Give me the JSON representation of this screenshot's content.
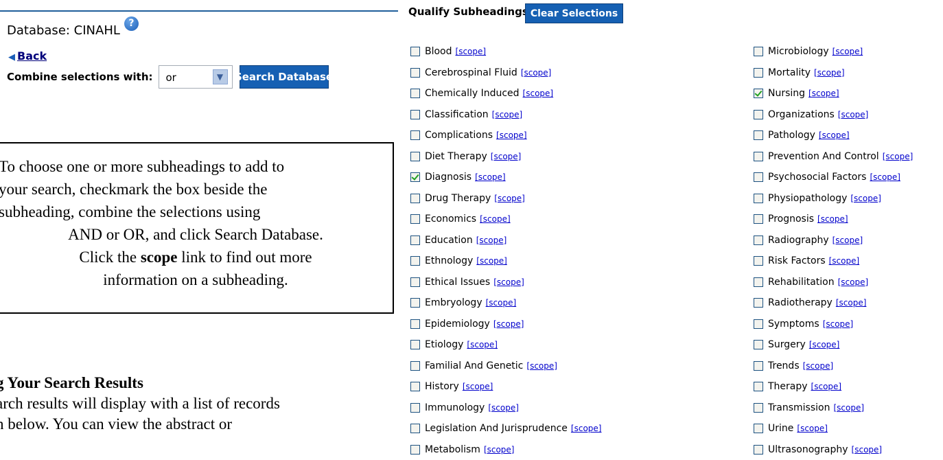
{
  "header": {
    "database_label": "Database: CINAHL",
    "help_icon": "question-circle-icon",
    "back_label": "Back",
    "combine_label": "Combine selections with:",
    "combine_value": "or",
    "search_button": "Search Database"
  },
  "instructions": {
    "lines": [
      "To choose one or more subheadings to add to",
      "your search, checkmark the box beside the",
      "subheading, combine the selections using",
      "AND or OR, and click Search Database.",
      "Click the ",
      "scope",
      " link to find out more",
      "information on a subheading."
    ]
  },
  "viewing": {
    "title_prefix": "g ",
    "title": "Your Search Results",
    "line1": "arch results will display with a list of records",
    "line2": "n below.  You can view the abstract or"
  },
  "subheadings": {
    "label": "Qualify Subheadings:",
    "clear_button": "Clear Selections",
    "scope_text": "[scope]",
    "left": [
      {
        "label": "Blood",
        "checked": false
      },
      {
        "label": "Cerebrospinal Fluid",
        "checked": false
      },
      {
        "label": "Chemically Induced",
        "checked": false
      },
      {
        "label": "Classification",
        "checked": false
      },
      {
        "label": "Complications",
        "checked": false
      },
      {
        "label": "Diet Therapy",
        "checked": false
      },
      {
        "label": "Diagnosis",
        "checked": true
      },
      {
        "label": "Drug Therapy",
        "checked": false
      },
      {
        "label": "Economics",
        "checked": false
      },
      {
        "label": "Education",
        "checked": false
      },
      {
        "label": "Ethnology",
        "checked": false
      },
      {
        "label": "Ethical Issues",
        "checked": false
      },
      {
        "label": "Embryology",
        "checked": false
      },
      {
        "label": "Epidemiology",
        "checked": false
      },
      {
        "label": "Etiology",
        "checked": false
      },
      {
        "label": "Familial And Genetic",
        "checked": false
      },
      {
        "label": "History",
        "checked": false
      },
      {
        "label": "Immunology",
        "checked": false
      },
      {
        "label": "Legislation And Jurisprudence",
        "checked": false
      },
      {
        "label": "Metabolism",
        "checked": false
      }
    ],
    "right": [
      {
        "label": "Microbiology",
        "checked": false
      },
      {
        "label": "Mortality",
        "checked": false
      },
      {
        "label": "Nursing",
        "checked": true
      },
      {
        "label": "Organizations",
        "checked": false
      },
      {
        "label": "Pathology",
        "checked": false
      },
      {
        "label": "Prevention And Control",
        "checked": false
      },
      {
        "label": "Psychosocial Factors",
        "checked": false
      },
      {
        "label": "Physiopathology",
        "checked": false
      },
      {
        "label": "Prognosis",
        "checked": false
      },
      {
        "label": "Radiography",
        "checked": false
      },
      {
        "label": "Risk Factors",
        "checked": false
      },
      {
        "label": "Rehabilitation",
        "checked": false
      },
      {
        "label": "Radiotherapy",
        "checked": false
      },
      {
        "label": "Symptoms",
        "checked": false
      },
      {
        "label": "Surgery",
        "checked": false
      },
      {
        "label": "Trends",
        "checked": false
      },
      {
        "label": "Therapy",
        "checked": false
      },
      {
        "label": "Transmission",
        "checked": false
      },
      {
        "label": "Urine",
        "checked": false
      },
      {
        "label": "Ultrasonography",
        "checked": false
      }
    ]
  }
}
